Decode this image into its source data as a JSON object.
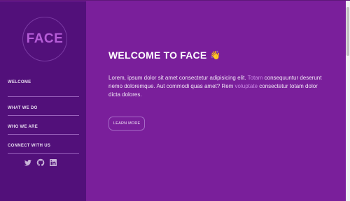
{
  "colors": {
    "main_bg": "#7a1f9b",
    "sidebar_bg": "#52107a",
    "logo_text": "#b65dd8",
    "highlight": "#cb8ae6"
  },
  "sidebar": {
    "logo": "FACE",
    "nav": [
      {
        "label": "WELCOME"
      },
      {
        "label": "WHAT WE DO"
      },
      {
        "label": "WHO WE ARE"
      },
      {
        "label": "CONNECT WITH US"
      }
    ],
    "socials": [
      "twitter-icon",
      "github-icon",
      "linkedin-icon"
    ]
  },
  "hero": {
    "title": "WELCOME TO FACE",
    "emoji": "👋",
    "paragraph": {
      "part1": "Lorem, ipsum dolor sit amet consectetur adipisicing elit. ",
      "link1": "Totam",
      "part2": " consequuntur deserunt nemo doloremque. Aut commodi quas amet? Rem ",
      "link2": "voluptate",
      "part3": " consectetur totam dolor dicta dolores."
    },
    "button_label": "LEARN MORE"
  }
}
